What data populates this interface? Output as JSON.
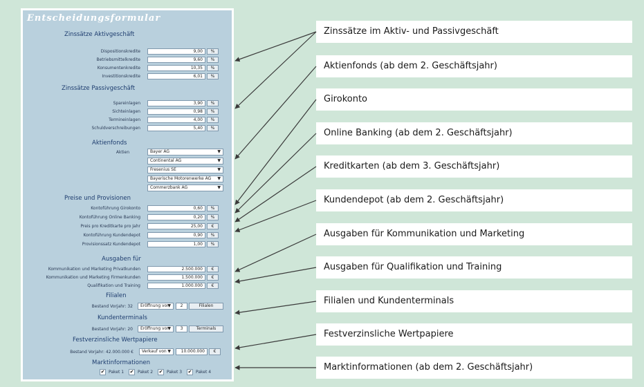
{
  "form": {
    "title": "Entscheidungsformular",
    "aktiv": {
      "heading": "Zinssätze Aktivgeschäft",
      "rows": [
        {
          "label": "Dispositionskredite",
          "value": "9,00",
          "unit": "%"
        },
        {
          "label": "Betriebsmittelkredite",
          "value": "9,60",
          "unit": "%"
        },
        {
          "label": "Konsumentenkredite",
          "value": "10,35",
          "unit": "%"
        },
        {
          "label": "Investitionskredite",
          "value": "6,01",
          "unit": "%"
        }
      ]
    },
    "passiv": {
      "heading": "Zinssätze Passivgeschäft",
      "rows": [
        {
          "label": "Spareinlagen",
          "value": "3,90",
          "unit": "%"
        },
        {
          "label": "Sichteinlagen",
          "value": "0,98",
          "unit": "%"
        },
        {
          "label": "Termineinlagen",
          "value": "4,00",
          "unit": "%"
        },
        {
          "label": "Schuldverschreibungen",
          "value": "5,40",
          "unit": "%"
        }
      ]
    },
    "aktienfonds": {
      "heading": "Aktienfonds",
      "label": "Aktien",
      "options": [
        "Bayer AG",
        "Continental AG",
        "Fresenius SE",
        "Bayerische Motorenwerke AG",
        "Commerzbank AG"
      ]
    },
    "preise": {
      "heading": "Preise und Provisionen",
      "rows": [
        {
          "label": "Kontoführung Girokonto",
          "value": "0,60",
          "unit": "%"
        },
        {
          "label": "Kontoführung Online Banking",
          "value": "0,20",
          "unit": "%"
        },
        {
          "label": "Preis pro Kreditkarte pro Jahr",
          "value": "25,00",
          "unit": "€"
        },
        {
          "label": "Kontoführung Kundendepot",
          "value": "0,90",
          "unit": "%"
        },
        {
          "label": "Provisionssatz Kundendepot",
          "value": "1,00",
          "unit": "%"
        }
      ]
    },
    "ausgaben": {
      "heading": "Ausgaben für",
      "rows": [
        {
          "label": "Kommunikation und Marketing Privatkunden",
          "value": "2.500.000",
          "unit": "€"
        },
        {
          "label": "Kommunikation und Marketing Firmenkunden",
          "value": "1.500.000",
          "unit": "€"
        },
        {
          "label": "Qualifikation und Training",
          "value": "1.000.000",
          "unit": "€"
        }
      ]
    },
    "filialen": {
      "heading": "Filialen",
      "label": "Bestand Vorjahr: 32",
      "select": "Eröffnung von",
      "value": "2",
      "button": "Filialen"
    },
    "kundenterminals": {
      "heading": "Kundenterminals",
      "label": "Bestand Vorjahr: 20",
      "select": "Eröffnung von",
      "value": "3",
      "button": "Terminals"
    },
    "wertpapiere": {
      "heading": "Festverzinsliche Wertpapiere",
      "label": "Bestand Vorjahr: 42.000.000 €",
      "select": "Verkauf von",
      "value": "10.000.000",
      "unit": "€"
    },
    "markt": {
      "heading": "Marktinformationen",
      "check_mark": "✔",
      "pakete": [
        {
          "label": "Paket 1",
          "checked": true
        },
        {
          "label": "Paket 2",
          "checked": true
        },
        {
          "label": "Paket 3",
          "checked": true
        },
        {
          "label": "Paket 4",
          "checked": true
        }
      ]
    }
  },
  "callouts": [
    "Zinssätze im Aktiv- und Passivgeschäft",
    "Aktienfonds (ab dem 2. Geschäftsjahr)",
    "Girokonto",
    "Online Banking (ab dem 2. Geschäftsjahr)",
    "Kreditkarten (ab dem 3. Geschäftsjahr)",
    "Kundendepot (ab dem 2. Geschäftsjahr)",
    "Ausgaben für Kommunikation und Marketing",
    "Ausgaben für Qualifikation und Training",
    "Filialen und Kundenterminals",
    "Festverzinsliche Wertpapiere",
    "Marktinformationen (ab dem 2. Geschäftsjahr)"
  ],
  "colors": {
    "background": "#cfe6d8",
    "form_panel": "#b9d0dd",
    "heading": "#1d3c6e",
    "arrow": "#3a3a3a"
  }
}
